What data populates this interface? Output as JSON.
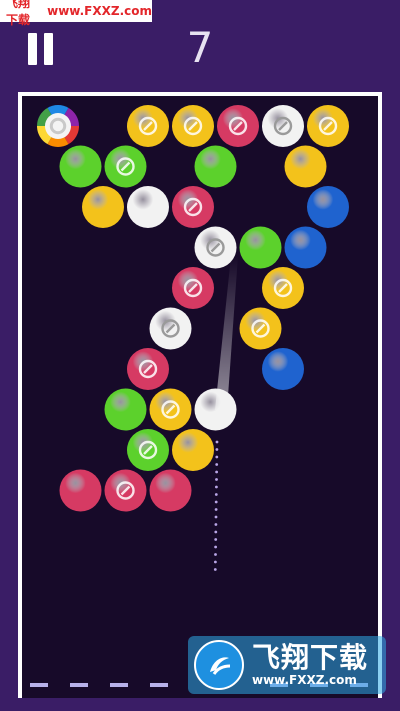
{
  "banner": {
    "site_name": "飞翔下载",
    "site_url": "www.FXXZ.com"
  },
  "hud": {
    "score": "7",
    "pause_icon": "pause-icon"
  },
  "watermark": {
    "brand": "飞翔下载",
    "url": "www.FXXZ.com"
  },
  "colors": {
    "background": "#3a1d66",
    "board": "#170a29",
    "yellow": "#f3c21b",
    "green": "#5cd12c",
    "red": "#d63a63",
    "white": "#f2f2f2",
    "blue": "#1f63cf",
    "rainbow": "rainbow"
  },
  "board": {
    "bubbles": [
      {
        "color": "rainbow",
        "locked": false,
        "row": 0,
        "col": 0.8
      },
      {
        "color": "yellow",
        "locked": true,
        "row": 0,
        "col": 2.8
      },
      {
        "color": "yellow",
        "locked": true,
        "row": 0,
        "col": 3.8
      },
      {
        "color": "red",
        "locked": true,
        "row": 0,
        "col": 4.8
      },
      {
        "color": "white",
        "locked": true,
        "row": 0,
        "col": 5.8
      },
      {
        "color": "yellow",
        "locked": true,
        "row": 0,
        "col": 6.8
      },
      {
        "color": "green",
        "locked": false,
        "row": 1,
        "col": 1.3
      },
      {
        "color": "green",
        "locked": true,
        "row": 1,
        "col": 2.3
      },
      {
        "color": "green",
        "locked": false,
        "row": 1,
        "col": 4.3
      },
      {
        "color": "yellow",
        "locked": false,
        "row": 1,
        "col": 6.3
      },
      {
        "color": "yellow",
        "locked": false,
        "row": 2,
        "col": 1.8
      },
      {
        "color": "white",
        "locked": false,
        "row": 2,
        "col": 2.8
      },
      {
        "color": "red",
        "locked": true,
        "row": 2,
        "col": 3.8
      },
      {
        "color": "blue",
        "locked": false,
        "row": 2,
        "col": 6.8
      },
      {
        "color": "white",
        "locked": true,
        "row": 3,
        "col": 4.3
      },
      {
        "color": "green",
        "locked": false,
        "row": 3,
        "col": 5.3
      },
      {
        "color": "blue",
        "locked": false,
        "row": 3,
        "col": 6.3
      },
      {
        "color": "red",
        "locked": true,
        "row": 4,
        "col": 3.8
      },
      {
        "color": "yellow",
        "locked": true,
        "row": 4,
        "col": 5.8
      },
      {
        "color": "white",
        "locked": true,
        "row": 5,
        "col": 3.3
      },
      {
        "color": "yellow",
        "locked": true,
        "row": 5,
        "col": 5.3
      },
      {
        "color": "red",
        "locked": true,
        "row": 6,
        "col": 2.8
      },
      {
        "color": "blue",
        "locked": false,
        "row": 6,
        "col": 5.8
      },
      {
        "color": "green",
        "locked": false,
        "row": 7,
        "col": 2.3
      },
      {
        "color": "yellow",
        "locked": true,
        "row": 7,
        "col": 3.3
      },
      {
        "color": "white",
        "locked": false,
        "row": 7,
        "col": 4.3
      },
      {
        "color": "green",
        "locked": true,
        "row": 8,
        "col": 2.8
      },
      {
        "color": "yellow",
        "locked": false,
        "row": 8,
        "col": 3.8
      },
      {
        "color": "red",
        "locked": false,
        "row": 9,
        "col": 1.3
      },
      {
        "color": "red",
        "locked": true,
        "row": 9,
        "col": 2.3
      },
      {
        "color": "red",
        "locked": false,
        "row": 9,
        "col": 3.3
      }
    ]
  }
}
